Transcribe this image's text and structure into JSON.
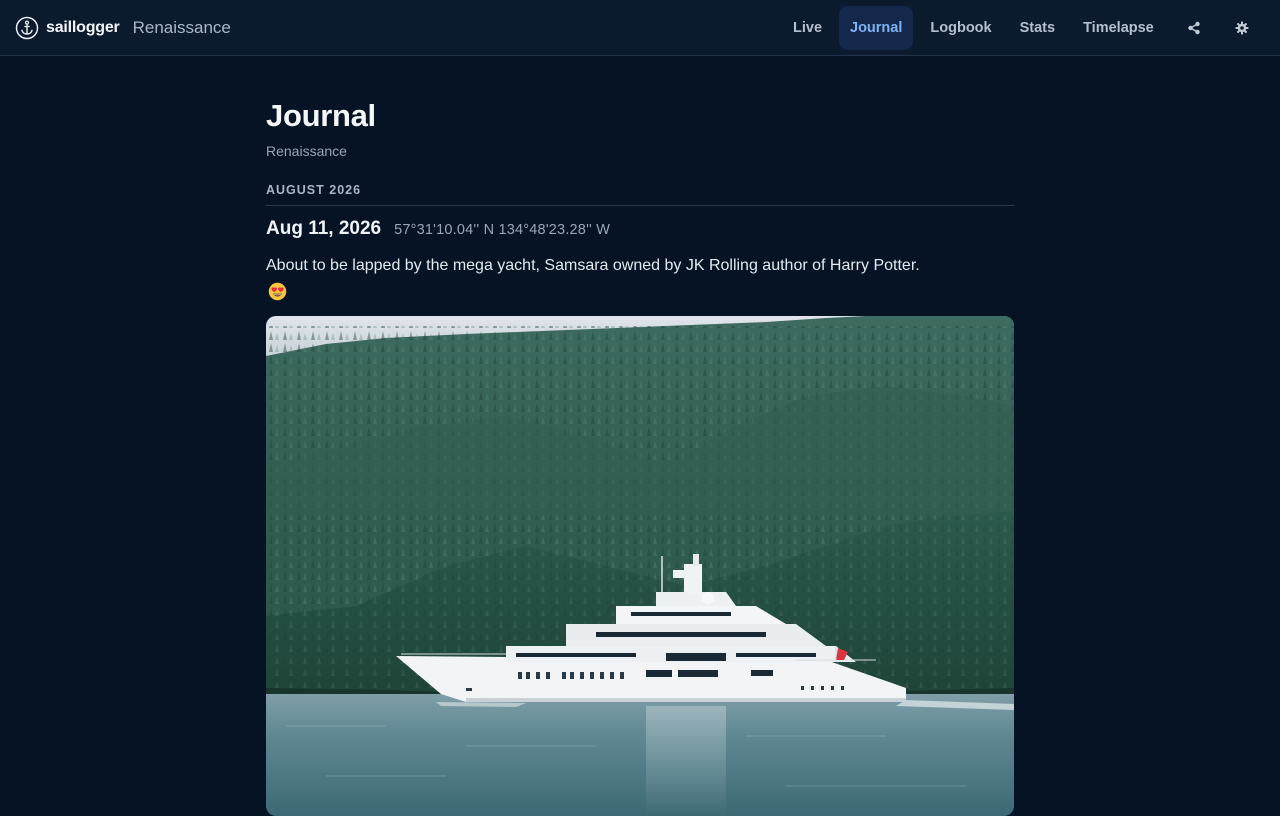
{
  "app": {
    "brand": "saillogger",
    "boat": "Renaissance"
  },
  "nav": [
    {
      "label": "Live"
    },
    {
      "label": "Journal"
    },
    {
      "label": "Logbook"
    },
    {
      "label": "Stats"
    },
    {
      "label": "Timelapse"
    }
  ],
  "nav_active": "Journal",
  "icons": {
    "logo": "anchor-icon",
    "share": "share-icon",
    "settings": "gear-icon"
  },
  "page": {
    "title": "Journal",
    "subtitle": "Renaissance"
  },
  "month": "AUGUST 2026",
  "entry": {
    "date": "Aug 11, 2026",
    "coords": "57°31'10.04'' N 134°48'23.28'' W",
    "text": "About to be lapped by the mega yacht, Samsara owned by JK Rolling author of Harry Potter.",
    "emoji": "heart-eyes-emoji"
  },
  "colors": {
    "background": "#061325",
    "topbar": "#0c1a2d",
    "accent": "#7fb2f2",
    "active_tab_bg": "#13284a"
  }
}
